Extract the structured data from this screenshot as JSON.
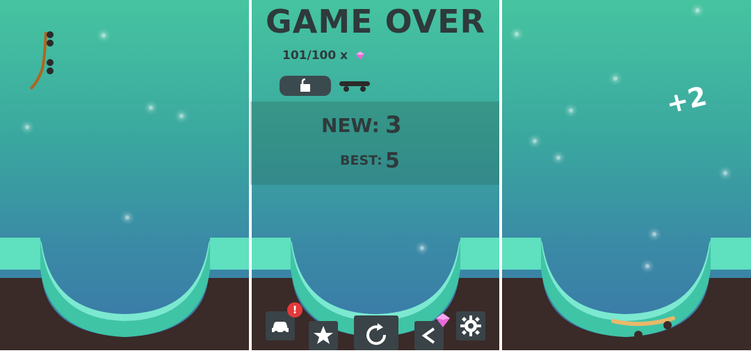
{
  "game_over": {
    "title": "GAME OVER",
    "gems_text": "101/100 x",
    "new_label": "NEW:",
    "new_score": "3",
    "best_label": "BEST:",
    "best_score": "5"
  },
  "popup_text": "+2",
  "bottom_bar": {
    "buttons": [
      {
        "name": "garage-button",
        "icon": "car-icon",
        "badge": "!"
      },
      {
        "name": "rate-button",
        "icon": "star-icon"
      },
      {
        "name": "restart-button",
        "icon": "restart-icon"
      },
      {
        "name": "share-button",
        "icon": "share-icon",
        "badge_icon": "gem-icon"
      },
      {
        "name": "settings-button",
        "icon": "gear-icon"
      }
    ]
  },
  "colors": {
    "sky_top": "#46c4a0",
    "sky_bottom": "#3b77a8",
    "ramp_top": "#5fe0bf",
    "ramp_side": "#3a2a28",
    "text_dark": "#2e3a3b",
    "gem": "#e86ad8"
  }
}
